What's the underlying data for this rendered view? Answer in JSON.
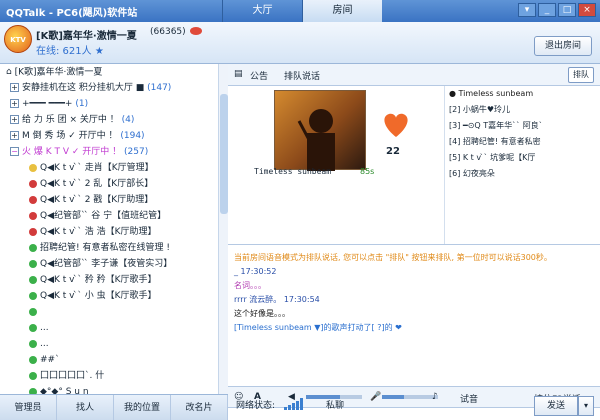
{
  "app": {
    "title": "QQTalk - PC6(飓风)软件站"
  },
  "tabs": [
    {
      "label": "大厅",
      "active": false
    },
    {
      "label": "房间",
      "active": true
    }
  ],
  "room": {
    "name": "[K歌]嘉年华·激情一夏",
    "id": "(66365)",
    "online": "在线: 621人 ★",
    "exit_label": "退出房间"
  },
  "tree": {
    "root": "[K歌]嘉年华·激情一夏",
    "groups": [
      {
        "label": "安静挂机在这   积分挂机大厅  ■",
        "count": "(147)"
      },
      {
        "label": "+━━━             ━━━+",
        "count": "(1)"
      },
      {
        "label": "给 力 乐 团    × 关厅中 ！",
        "count": "(4)"
      },
      {
        "label": "M 倒 秀 场    ✓ 开厅中 ！",
        "count": "(194)"
      },
      {
        "label": "火 爆 K T V    ✓ 开厅中 ！",
        "count": "(257)"
      }
    ],
    "members": [
      {
        "name": "Q◀K t v ̀` 走肖【K厅管理】",
        "color": "#e8c040"
      },
      {
        "name": "Q◀K t v ̀` 2  乱【K厅部长】",
        "color": "#d23b3b"
      },
      {
        "name": "Q◀K t v ̀` 2  戳【K厅助理】",
        "color": "#d23b3b"
      },
      {
        "name": "Q◀纪管部` ̀ 谷  宁【值班纪管】",
        "color": "#d23b3b"
      },
      {
        "name": "Q◀K t v ̀` 浩  浩【K厅助理】",
        "color": "#d23b3b"
      },
      {
        "name": "招聘纪管! 有意者私密在线管理  !",
        "color": "#3bb04a"
      },
      {
        "name": "Q◀纪管部` ̀ 李子谦【夜管实习】",
        "color": "#3bb04a"
      },
      {
        "name": "Q◀K t v ̀` 矜  矜【K厅歌手】",
        "color": "#3bb04a"
      },
      {
        "name": "Q◀K t v ̀` 小  虫【K厅歌手】",
        "color": "#3bb04a"
      },
      {
        "name": "",
        "color": "#3bb04a"
      },
      {
        "name": "...",
        "color": "#3bb04a"
      },
      {
        "name": "...",
        "color": "#3bb04a"
      },
      {
        "name": "##`",
        "color": "#3bb04a"
      },
      {
        "name": "囗囗囗囗囗`.  什",
        "color": "#3bb04a"
      },
      {
        "name": "◆°◆°  S u n",
        "color": "#3bb04a"
      },
      {
        "name": "━ ⊙Q T 嘉年华`` Dream ❤ ",
        "color": "#3bb04a"
      }
    ]
  },
  "leftbar": [
    "管理员",
    "找人",
    "我的位置",
    "改名片"
  ],
  "right_toolbar": {
    "notice": "公告",
    "queue_speak": "排队说话",
    "queue_btn": "排队"
  },
  "mic": {
    "singer": "Timeless  sunbeam",
    "hearts": "22",
    "timer": "85s"
  },
  "queue": [
    {
      "name": "● Timeless  sunbeam",
      "color": "#3bb04a"
    },
    {
      "name": "[2] 小蜗牛♥玲儿",
      "color": "#888"
    },
    {
      "name": "[3] ━⊙Q T嘉年华`` 阿良`",
      "color": "#888"
    },
    {
      "name": "[4] 招聘纪管! 有意者私密",
      "color": "#d23b3b"
    },
    {
      "name": "[5] K t v ̀` 坑爹呢【K厅",
      "color": "#888"
    },
    {
      "name": "[6] 幻夜亮朵",
      "color": "#888"
    }
  ],
  "chat": {
    "notice": "当前房间语音模式为排队说话, 您可以点击 \"排队\" 按钮来排队, 第一位时可以说话300秒。",
    "lines": [
      {
        "text": "_ 17:30:52",
        "color": "#2a4fa8"
      },
      {
        "text": "   名词。。。",
        "color": "#b03ab0"
      },
      {
        "text": "rrrr        流云醉。        17:30:54",
        "color": "#2a4fa8"
      },
      {
        "text": "   这个好像是。。。",
        "color": "#1a1a1a"
      },
      {
        "text": "[Timeless   sunbeam     ▼]的歌声打动了[           ?]的 ❤",
        "color": "#2a6fcf"
      }
    ]
  },
  "chat_toolbar": {
    "listen": "试音",
    "mode": "按住F2说话"
  },
  "footer": {
    "network_status": "网络状态:",
    "private_chat": "私聊",
    "send": "发送"
  }
}
